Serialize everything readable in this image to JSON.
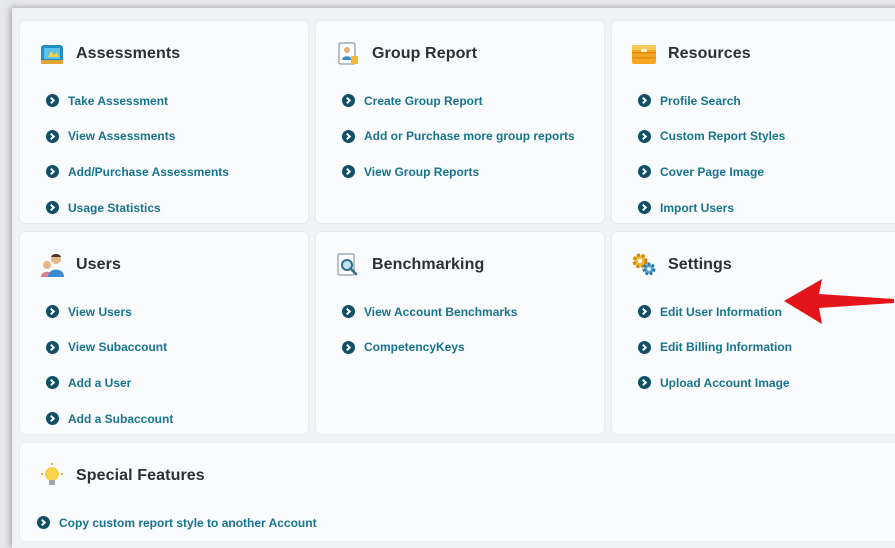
{
  "cards": [
    {
      "title": "Assessments",
      "icon": "assessments-icon",
      "links": [
        "Take Assessment",
        "View Assessments",
        "Add/Purchase Assessments",
        "Usage Statistics"
      ]
    },
    {
      "title": "Group Report",
      "icon": "group-report-icon",
      "links": [
        "Create Group Report",
        "Add or Purchase more group reports",
        "View Group Reports"
      ]
    },
    {
      "title": "Resources",
      "icon": "resources-icon",
      "links": [
        "Profile Search",
        "Custom Report Styles",
        "Cover Page Image",
        "Import Users"
      ]
    },
    {
      "title": "Users",
      "icon": "users-icon",
      "links": [
        "View Users",
        "View Subaccount",
        "Add a User",
        "Add a Subaccount"
      ]
    },
    {
      "title": "Benchmarking",
      "icon": "benchmarking-icon",
      "links": [
        "View Account Benchmarks",
        "CompetencyKeys"
      ]
    },
    {
      "title": "Settings",
      "icon": "settings-icon",
      "links": [
        "Edit User Information",
        "Edit Billing Information",
        "Upload Account Image"
      ]
    },
    {
      "title": "Special Features",
      "icon": "lightbulb-icon",
      "links": [
        "Copy custom report style to another Account"
      ]
    }
  ],
  "colors": {
    "link": "#17748f",
    "bullet": "#114f66",
    "title": "#2b2f36",
    "arrow": "#e3151b",
    "background": "#f1f2f4"
  },
  "annotation": {
    "icon": "red-arrow-icon",
    "target": "Edit User Information"
  }
}
